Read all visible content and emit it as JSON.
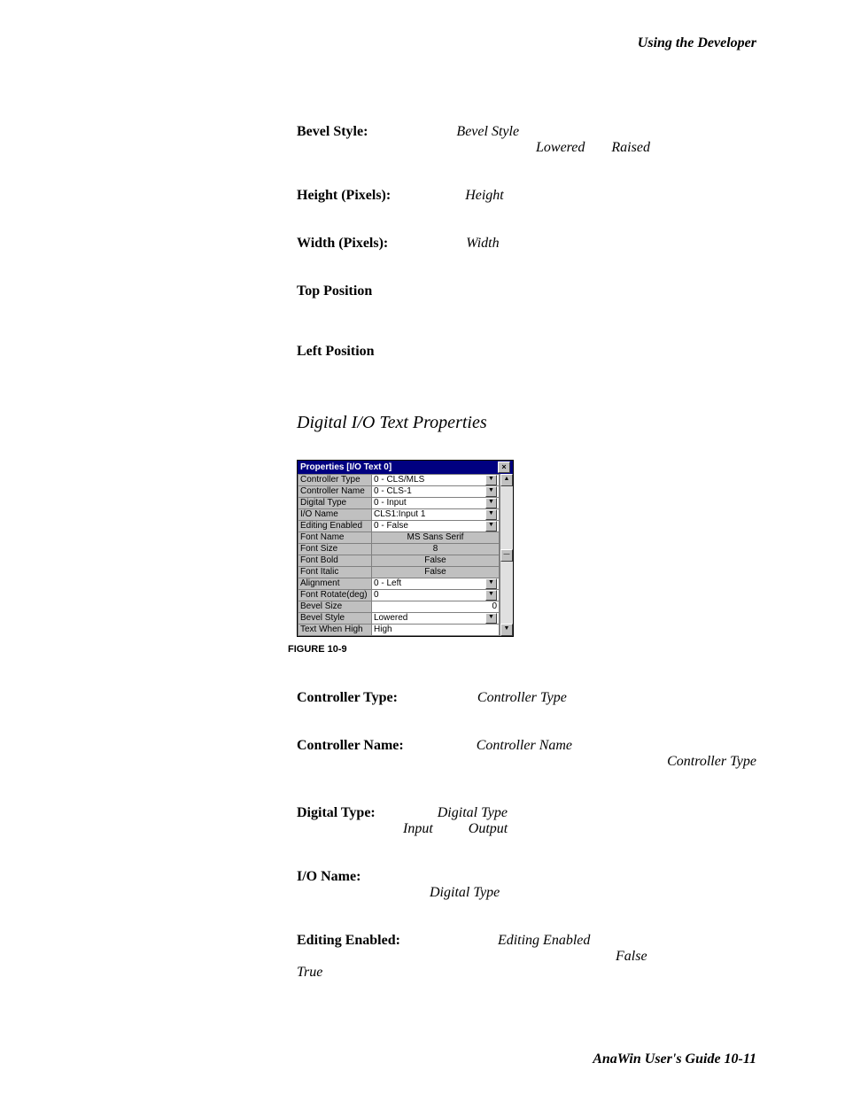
{
  "page_header": "Using the Developer",
  "page_footer": "AnaWin User's Guide  10-11",
  "section1": {
    "bevel_style_label": "Bevel Style:",
    "bevel_style_val": "Bevel Style",
    "bevel_lowered": "Lowered",
    "bevel_raised": "Raised",
    "height_label": "Height (Pixels):",
    "height_val": "Height",
    "width_label": "Width (Pixels):",
    "width_val": "Width",
    "top_label": "Top Position",
    "left_label": "Left Position"
  },
  "section_title": "Digital I/O Text Properties",
  "figure_caption": "FIGURE 10-9",
  "win": {
    "title": "Properties [I/O Text 0]",
    "rows": [
      {
        "label": "Controller Type",
        "value": "0 - CLS/MLS",
        "white": true,
        "dd": true
      },
      {
        "label": "Controller Name",
        "value": "0 - CLS-1",
        "white": true,
        "dd": true
      },
      {
        "label": "Digital Type",
        "value": "0 - Input",
        "white": true,
        "dd": true
      },
      {
        "label": "I/O Name",
        "value": "CLS1:Input 1",
        "white": true,
        "dd": true
      },
      {
        "label": "Editing Enabled",
        "value": "0 - False",
        "white": true,
        "dd": true
      },
      {
        "label": "Font Name",
        "value": "MS Sans Serif",
        "center": true
      },
      {
        "label": "Font Size",
        "value": "8",
        "center": true
      },
      {
        "label": "Font Bold",
        "value": "False",
        "center": true
      },
      {
        "label": "Font Italic",
        "value": "False",
        "center": true
      },
      {
        "label": "Alignment",
        "value": "0 - Left",
        "white": true,
        "dd": true
      },
      {
        "label": "Font Rotate(deg)",
        "value": "0",
        "white": true,
        "dd": true
      },
      {
        "label": "Bevel Size",
        "value": "0",
        "num": true
      },
      {
        "label": "Bevel Style",
        "value": "Lowered",
        "white": true,
        "dd": true
      },
      {
        "label": "Text When High",
        "value": "High",
        "white": true
      }
    ]
  },
  "section2": {
    "ctype_label": "Controller Type:",
    "ctype_val": "Controller Type",
    "cname_label": "Controller Name:",
    "cname_val": "Controller Name",
    "cname_ref": "Controller Type",
    "dtype_label": "Digital Type:",
    "dtype_val": "Digital Type",
    "dtype_input": "Input",
    "dtype_output": "Output",
    "ioname_label": "I/O Name:",
    "ioname_ref": "Digital Type",
    "edit_label": "Editing Enabled:",
    "edit_val": "Editing Enabled",
    "edit_false": "False",
    "edit_true": "True"
  }
}
